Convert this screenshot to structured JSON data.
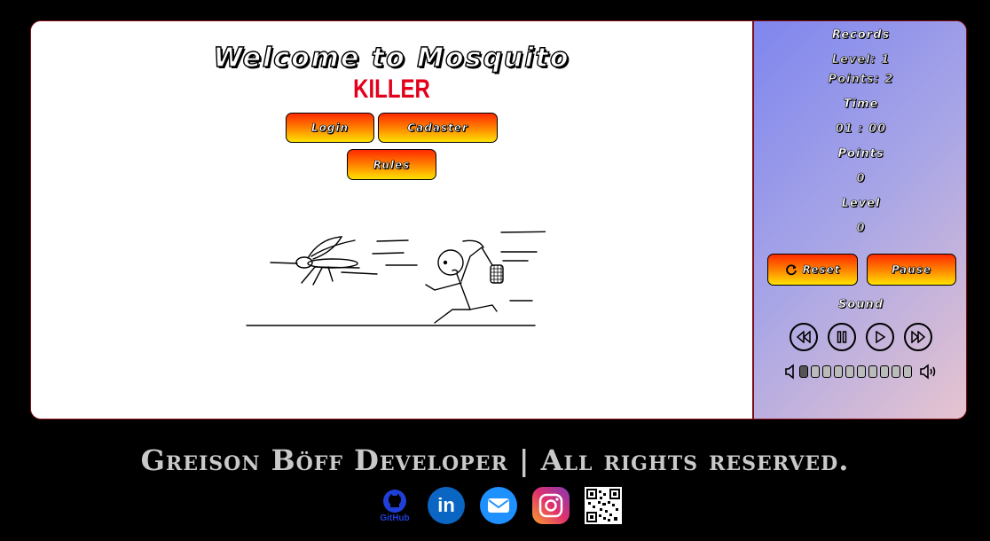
{
  "game": {
    "title_line1": "Welcome to Mosquito",
    "title_line2": "KILLER"
  },
  "menu": {
    "login_label": "Login",
    "register_label": "Cadaster",
    "rules_label": "Rules"
  },
  "panel": {
    "records_label": "Records",
    "records_level": "Level: 1",
    "records_points": "Points: 2",
    "time_label": "Time",
    "time_value": "01 : 00",
    "points_label": "Points",
    "points_value": "0",
    "level_label": "Level",
    "level_value": "0",
    "reset_label": "Reset",
    "pause_label": "Pause",
    "sound_label": "Sound",
    "volume_level": 0.1
  },
  "footer": {
    "text": "Greison Böff Developer | All rights reserved.",
    "github_label": "GitHub"
  },
  "colors": {
    "accent": "#ff8a00",
    "title_red": "#e3001b",
    "linkedin": "#0a66c2",
    "mail": "#1e90ff"
  }
}
